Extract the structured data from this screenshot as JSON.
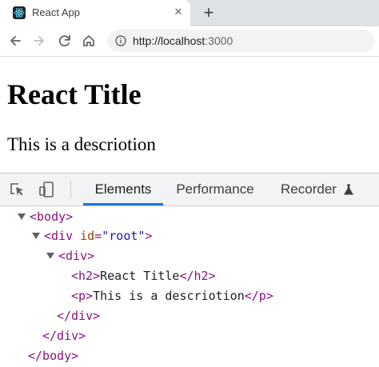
{
  "browser": {
    "tab": {
      "title": "React App",
      "close_glyph": "✕",
      "favicon": "react-logo-icon"
    },
    "new_tab_glyph": "+",
    "toolbar": {
      "url_host": "http://localhost",
      "url_port": ":3000"
    }
  },
  "page": {
    "heading": "React Title",
    "paragraph": "This is a descriotion"
  },
  "devtools": {
    "tabs": [
      {
        "label": "Elements",
        "active": true
      },
      {
        "label": "Performance",
        "active": false
      },
      {
        "label": "Recorder",
        "active": false
      }
    ],
    "tree": {
      "body_open": "<body>",
      "div_root_open_tag": "<div",
      "div_root_attr_name": "id",
      "div_root_attr_eq": "=",
      "div_root_attr_value": "\"root\"",
      "div_root_open_close": ">",
      "div_open": "<div>",
      "h2_open": "<h2>",
      "h2_text": "React Title",
      "h2_close": "</h2>",
      "p_open": "<p>",
      "p_text": "This is a descriotion",
      "p_close": "</p>",
      "div_close_inner": "</div>",
      "div_close_outer": "</div>",
      "body_close": "</body>"
    }
  },
  "colors": {
    "tag": "#881280",
    "attr_name": "#994500",
    "attr_value": "#1a1aa6",
    "active_tab_underline": "#1a73e8"
  }
}
